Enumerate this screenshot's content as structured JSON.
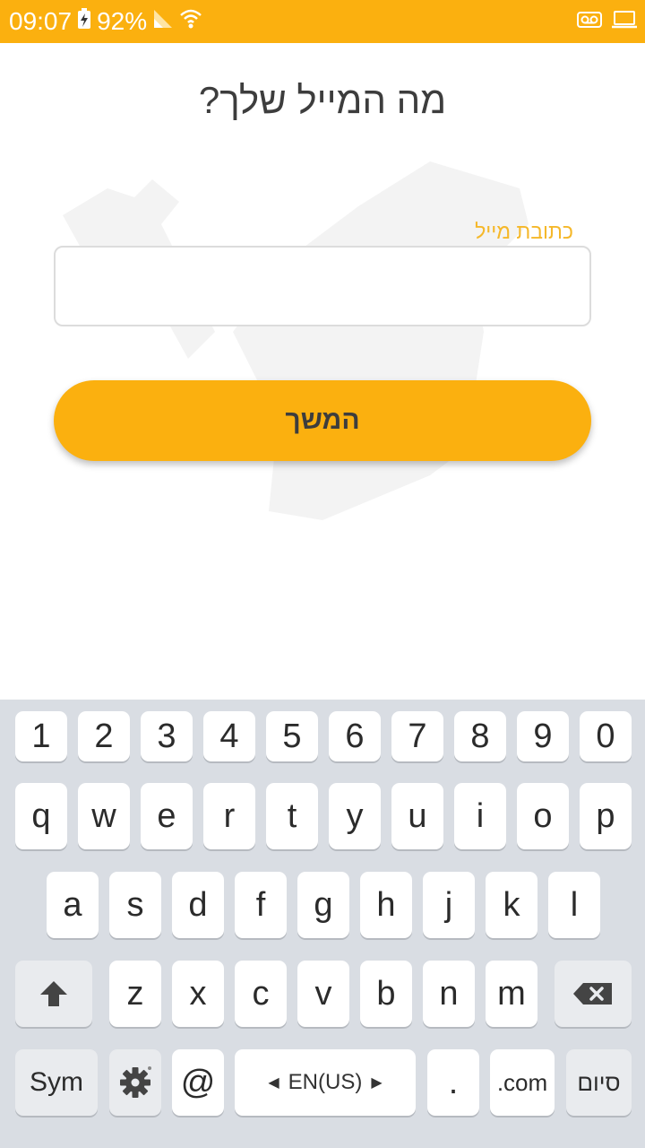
{
  "status_bar": {
    "time": "09:07",
    "battery": "92%"
  },
  "page": {
    "title": "מה המייל שלך?",
    "email_label": "כתובת מייל",
    "email_value": "",
    "continue_label": "המשך"
  },
  "keyboard": {
    "row1": [
      "1",
      "2",
      "3",
      "4",
      "5",
      "6",
      "7",
      "8",
      "9",
      "0"
    ],
    "row2": [
      "q",
      "w",
      "e",
      "r",
      "t",
      "y",
      "u",
      "i",
      "o",
      "p"
    ],
    "row3": [
      "a",
      "s",
      "d",
      "f",
      "g",
      "h",
      "j",
      "k",
      "l"
    ],
    "row4": [
      "z",
      "x",
      "c",
      "v",
      "b",
      "n",
      "m"
    ],
    "sym_label": "Sym",
    "at_label": "@",
    "language_label": "EN(US)",
    "period_label": ".",
    "dotcom_label": ".com",
    "done_label": "סיום"
  },
  "colors": {
    "accent": "#fbb00f",
    "label": "#f5b82a"
  },
  "icons": [
    "charging-battery-icon",
    "signal-icon",
    "wifi-icon",
    "voicemail-icon",
    "laptop-icon",
    "shift-icon",
    "settings-gear-icon",
    "backspace-icon"
  ]
}
